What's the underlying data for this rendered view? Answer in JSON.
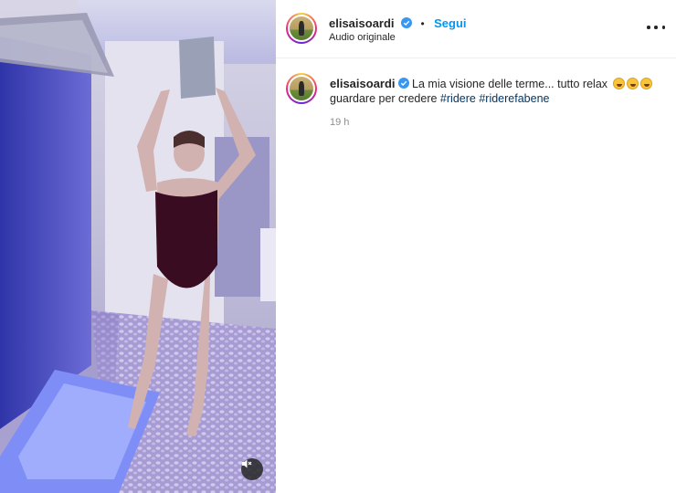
{
  "post": {
    "username": "elisaisoardi",
    "separator": "•",
    "follow_label": "Segui",
    "audio_label": "Audio originale",
    "caption_text": "La mia visione delle terme... tutto relax",
    "caption_line2": "guardare per credere",
    "hashtags": [
      "#ridere",
      "#riderefabene"
    ],
    "emoji_count": 3,
    "time_ago": "19 h"
  },
  "icons": {
    "verified": "verified-badge-icon",
    "more": "more-options-icon",
    "mute": "audio-muted-icon"
  },
  "colors": {
    "accent": "#0095f6",
    "hashtag": "#00376b",
    "muted_text": "#8e8e8e",
    "verified": "#3897f0"
  }
}
